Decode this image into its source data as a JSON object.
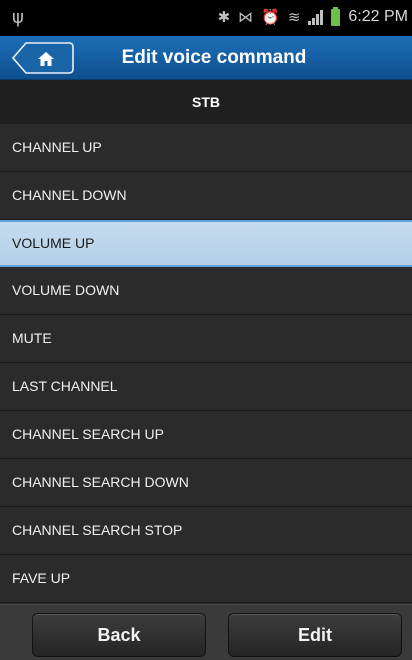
{
  "status_bar": {
    "time": "6:22 PM",
    "battery_color": "#6cc04a"
  },
  "header": {
    "title": "Edit voice command",
    "home_icon": "home-icon"
  },
  "section": {
    "label": "STB"
  },
  "commands": {
    "items": [
      {
        "label": "CHANNEL UP"
      },
      {
        "label": "CHANNEL DOWN"
      },
      {
        "label": "VOLUME UP",
        "selected": true
      },
      {
        "label": "VOLUME DOWN"
      },
      {
        "label": "MUTE"
      },
      {
        "label": "LAST CHANNEL"
      },
      {
        "label": "CHANNEL SEARCH UP"
      },
      {
        "label": "CHANNEL SEARCH DOWN"
      },
      {
        "label": "CHANNEL SEARCH STOP"
      },
      {
        "label": "FAVE UP"
      }
    ]
  },
  "footer": {
    "back_label": "Back",
    "edit_label": "Edit"
  },
  "colors": {
    "title_bar": "#1d6fb8",
    "selected_row": "#c6dcef",
    "selected_border": "#5fa3dc"
  }
}
